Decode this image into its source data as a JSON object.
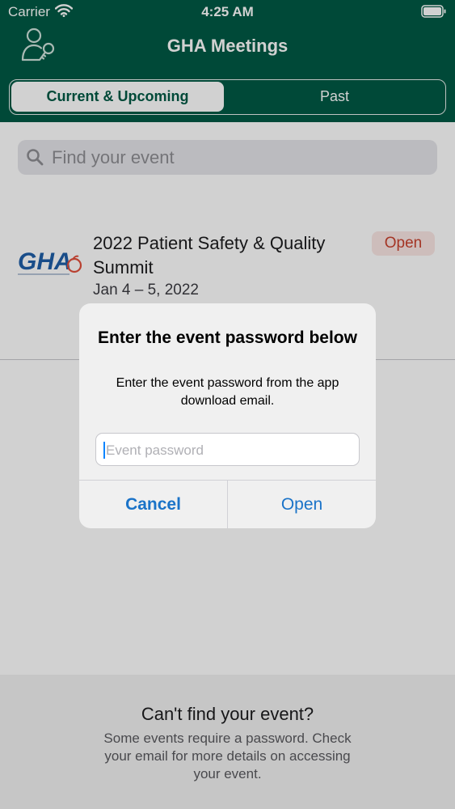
{
  "status_bar": {
    "carrier": "Carrier",
    "time": "4:25 AM"
  },
  "header": {
    "title": "GHA Meetings",
    "tabs": [
      {
        "label": "Current & Upcoming",
        "selected": true
      },
      {
        "label": "Past",
        "selected": false
      }
    ]
  },
  "search": {
    "placeholder": "Find your event"
  },
  "events": [
    {
      "title": "2022 Patient Safety & Quality Summit",
      "date": "Jan 4 – 5, 2022",
      "status": "Open",
      "logo_text": "GHA"
    }
  ],
  "footer": {
    "title": "Can't find your event?",
    "body": "Some events require a password. Check your email for more details on accessing your event."
  },
  "dialog": {
    "title": "Enter the event password below",
    "message": "Enter the event password from the app download email.",
    "input_placeholder": "Event password",
    "cancel_label": "Cancel",
    "open_label": "Open"
  },
  "colors": {
    "brand": "#005a45",
    "accent": "#1a73c8",
    "status_open": "#c8412e"
  },
  "icons": [
    "wifi-icon",
    "battery-icon",
    "profile-key-icon",
    "search-icon",
    "gha-logo"
  ]
}
